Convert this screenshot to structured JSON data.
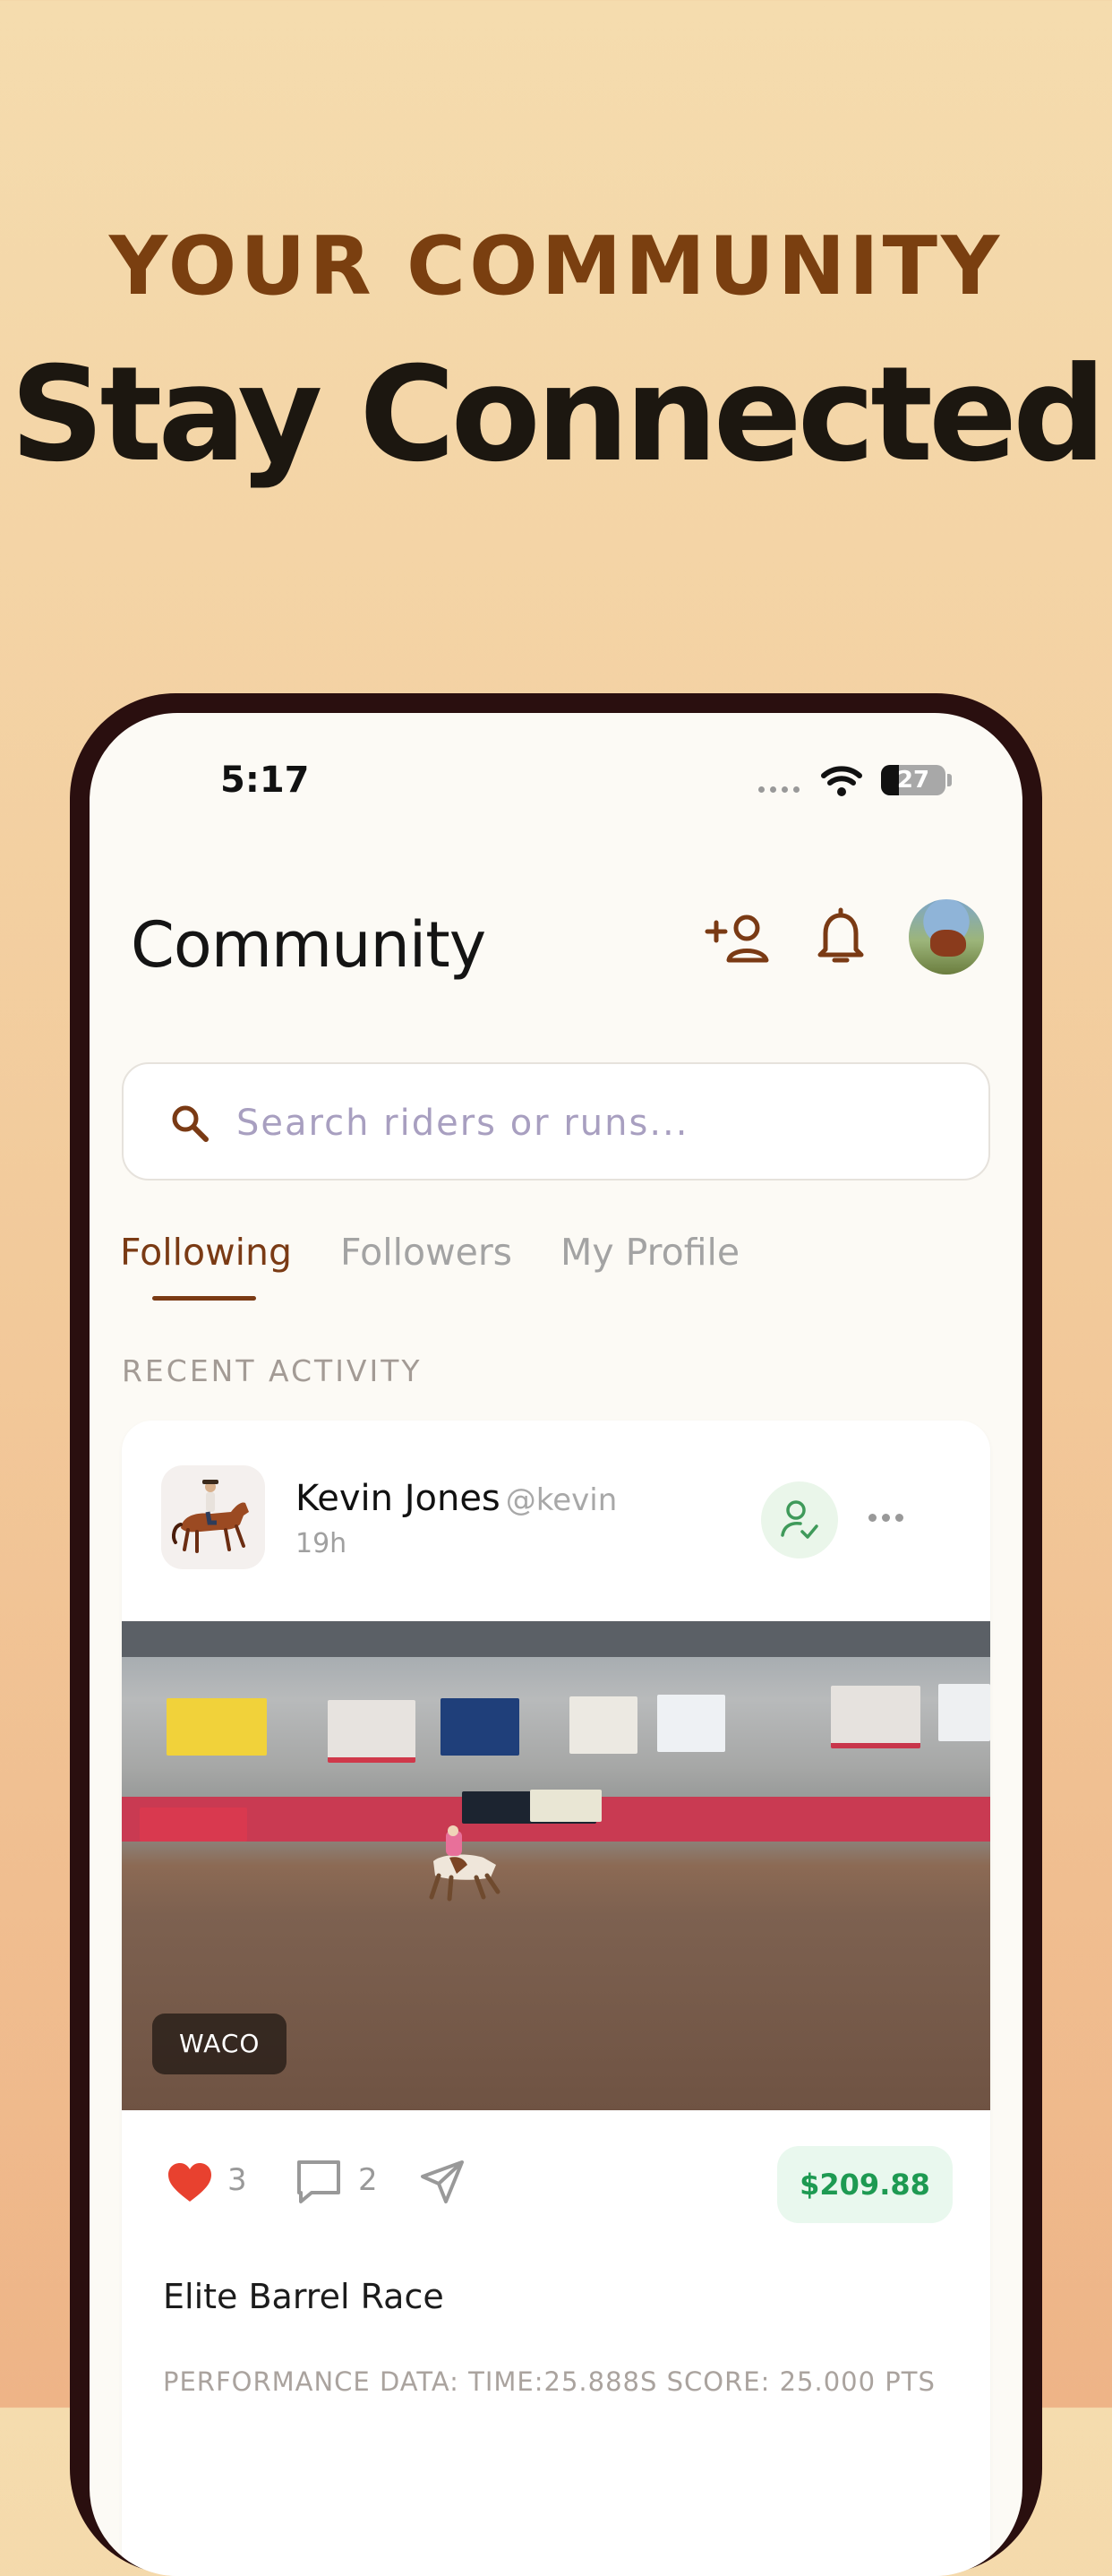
{
  "promo": {
    "subtitle": "YOUR COMMUNITY",
    "title": "Stay Connected"
  },
  "status_bar": {
    "time": "5:17",
    "battery": "27"
  },
  "header": {
    "title": "Community",
    "icons": [
      "add-user-icon",
      "bell-icon",
      "avatar"
    ]
  },
  "search": {
    "placeholder": "Search riders or runs..."
  },
  "tabs": [
    {
      "label": "Following",
      "active": true
    },
    {
      "label": "Followers",
      "active": false
    },
    {
      "label": "My Profile",
      "active": false
    }
  ],
  "section_label": "RECENT ACTIVITY",
  "post": {
    "name": "Kevin Jones",
    "handle": "@kevin",
    "time": "19h",
    "location": "WACO",
    "likes": "3",
    "comments": "2",
    "price": "$209.88",
    "event": "Elite Barrel Race",
    "performance": "PERFORMANCE DATA: TIME:25.888S  SCORE: 25.000 PTS"
  },
  "colors": {
    "accent": "#7a3a14",
    "like": "#e8412f",
    "price_text": "#1e9a52",
    "price_bg": "#e9f8ee",
    "follow_icon": "#3f9a5a"
  }
}
